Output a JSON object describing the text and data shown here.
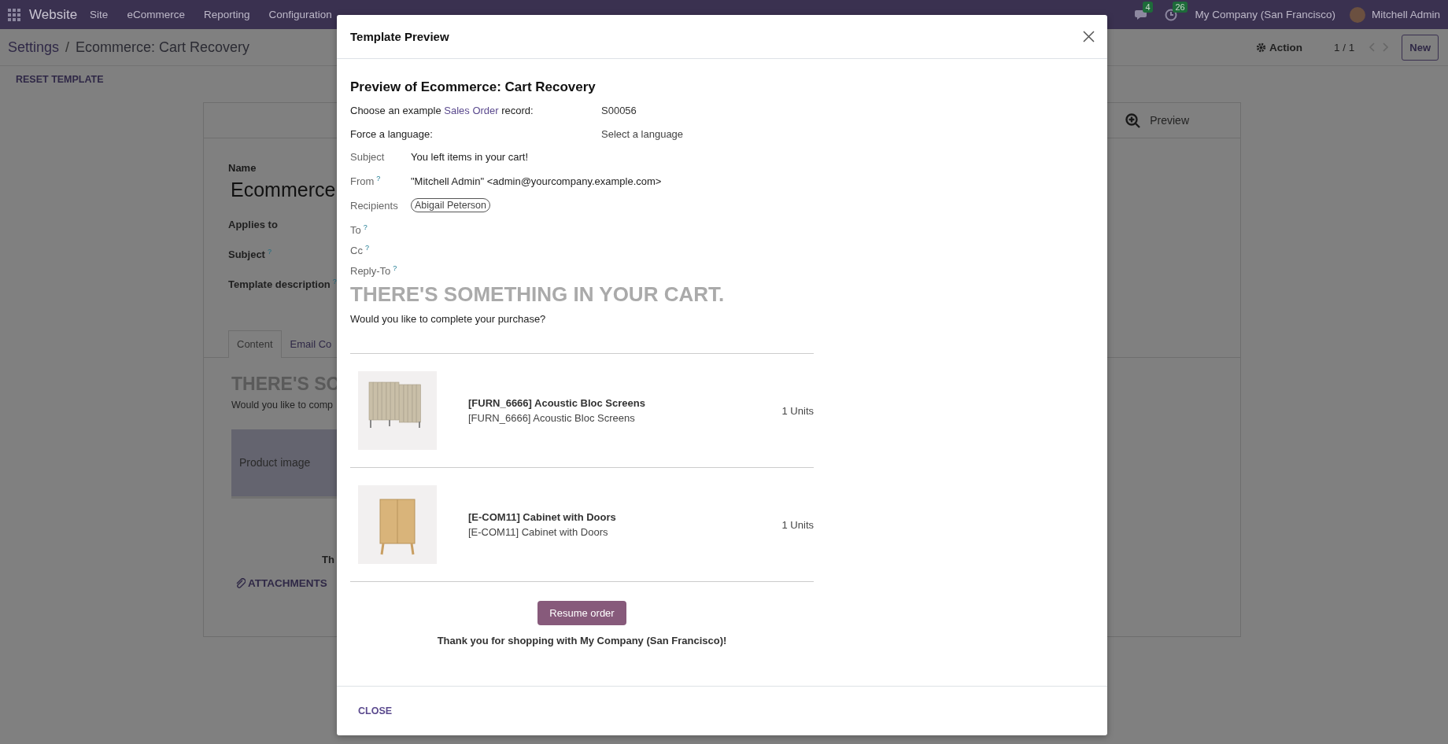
{
  "navbar": {
    "app_name": "Website",
    "menu": [
      "Site",
      "eCommerce",
      "Reporting",
      "Configuration"
    ],
    "messages_badge": "4",
    "activities_badge": "26",
    "company": "My Company (San Francisco)",
    "user": "Mitchell Admin"
  },
  "control_panel": {
    "breadcrumb": [
      "Settings",
      "Ecommerce: Cart Recovery"
    ],
    "breadcrumb_separator": "/",
    "action": "Action",
    "pager": "1 / 1",
    "new_button": "New",
    "reset_button": "RESET TEMPLATE"
  },
  "form": {
    "preview_button": "Preview",
    "name_label": "Name",
    "name_value": "Ecommerce",
    "fields": [
      {
        "label": "Applies to"
      },
      {
        "label": "Subject",
        "tooltip": "?"
      },
      {
        "label": "Template description",
        "tooltip": "?"
      }
    ],
    "tabs": [
      {
        "label": "Content",
        "selected": true
      },
      {
        "label": "Email Co",
        "selected": false
      }
    ],
    "body_heading": "THERE'S SO",
    "body_text": "Would you like to comp",
    "product_image_header": "Product image",
    "footer_text": "Th",
    "attachments": "ATTACHMENTS"
  },
  "dialog": {
    "title": "Template Preview",
    "heading": "Preview of Ecommerce: Cart Recovery",
    "record_prompt_before": "Choose an example",
    "record_link": "Sales Order",
    "record_prompt_after": "record:",
    "record_value": "S00056",
    "language_label": "Force a language:",
    "language_placeholder": "Select a language",
    "headers": [
      {
        "label": "Subject",
        "value": "You left items in your cart!"
      },
      {
        "label": "From",
        "tooltip": "?",
        "value": "\"Mitchell Admin\" <admin@yourcompany.example.com>"
      },
      {
        "label": "Recipients",
        "tags": [
          "Abigail Peterson"
        ]
      },
      {
        "label": "To",
        "tooltip": "?"
      },
      {
        "label": "Cc",
        "tooltip": "?"
      },
      {
        "label": "Reply-To",
        "tooltip": "?"
      }
    ],
    "email": {
      "heading": "THERE'S SOMETHING IN YOUR CART.",
      "intro": "Would you like to complete your purchase?",
      "lines": [
        {
          "kind": "screen",
          "name": "[FURN_6666] Acoustic Bloc Screens",
          "description": "[FURN_6666] Acoustic Bloc Screens",
          "quantity": "1 Units"
        },
        {
          "kind": "cabinet",
          "name": "[E-COM11] Cabinet with Doors",
          "description": "[E-COM11] Cabinet with Doors",
          "quantity": "1 Units"
        }
      ],
      "button": "Resume order",
      "thanks": "Thank you for shopping with My Company (San Francisco)!"
    },
    "close_button": "CLOSE"
  }
}
